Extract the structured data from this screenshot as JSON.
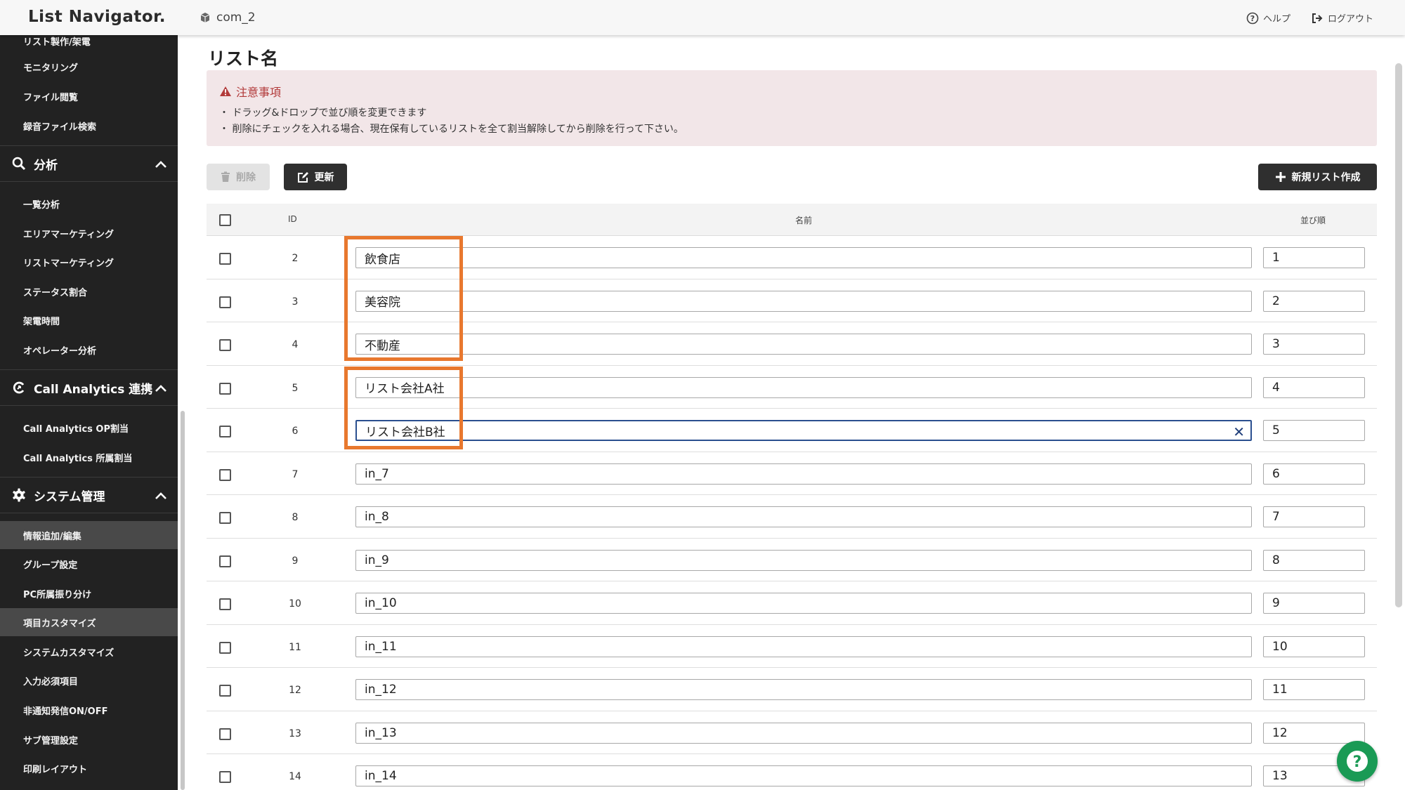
{
  "header": {
    "logo": "List Navigator.",
    "company": "com_2",
    "help": "ヘルプ",
    "logout": "ログアウト"
  },
  "sidebar": {
    "group1": [
      "リスト製作/架電",
      "モニタリング",
      "ファイル閲覧",
      "録音ファイル検索"
    ],
    "analysis": {
      "title": "分析",
      "items": [
        "一覧分析",
        "エリアマーケティング",
        "リストマーケティング",
        "ステータス割合",
        "架電時間",
        "オペレーター分析"
      ]
    },
    "call_analytics": {
      "title": "Call Analytics 連携",
      "items": [
        "Call Analytics OP割当",
        "Call Analytics 所属割当"
      ]
    },
    "system": {
      "title": "システム管理",
      "items": [
        "情報追加/編集",
        "グループ設定",
        "PC所属振り分け",
        "項目カスタマイズ",
        "システムカスタマイズ",
        "入力必須項目",
        "非通知発信ON/OFF",
        "サブ管理設定",
        "印刷レイアウト"
      ]
    }
  },
  "main": {
    "title": "リスト名",
    "notice": {
      "title": "注意事項",
      "lines": [
        "・ ドラッグ&ドロップで並び順を変更できます",
        "・ 削除にチェックを入れる場合、現在保有しているリストを全て割当解除してから削除を行って下さい。"
      ]
    },
    "buttons": {
      "delete": "削除",
      "update": "更新",
      "new_list": "新規リスト作成"
    },
    "table": {
      "headers": {
        "id": "ID",
        "name": "名前",
        "order": "並び順"
      },
      "rows": [
        {
          "id": "2",
          "name": "飲食店",
          "order": "1"
        },
        {
          "id": "3",
          "name": "美容院",
          "order": "2"
        },
        {
          "id": "4",
          "name": "不動産",
          "order": "3"
        },
        {
          "id": "5",
          "name": "リスト会社A社",
          "order": "4"
        },
        {
          "id": "6",
          "name": "リスト会社B社",
          "order": "5"
        },
        {
          "id": "7",
          "name": "in_7",
          "order": "6"
        },
        {
          "id": "8",
          "name": "in_8",
          "order": "7"
        },
        {
          "id": "9",
          "name": "in_9",
          "order": "8"
        },
        {
          "id": "10",
          "name": "in_10",
          "order": "9"
        },
        {
          "id": "11",
          "name": "in_11",
          "order": "10"
        },
        {
          "id": "12",
          "name": "in_12",
          "order": "11"
        },
        {
          "id": "13",
          "name": "in_13",
          "order": "12"
        },
        {
          "id": "14",
          "name": "in_14",
          "order": "13"
        }
      ]
    }
  },
  "colors": {
    "sidebar_bg": "#222222",
    "highlight": "#e8782e",
    "notice_bg": "#f2e6e8",
    "warning_red": "#b23a3a",
    "focus_blue": "#2a4f8f",
    "help_fab": "#1a9a55"
  },
  "icons": {
    "company": "cube-icon",
    "help": "question-circle-icon",
    "logout": "sign-out-icon",
    "analysis": "search-icon",
    "call_analytics": "call-analytics-icon",
    "system": "gear-icon",
    "warning": "warning-triangle-icon",
    "delete": "trash-icon",
    "update": "edit-icon",
    "new_list": "plus-icon",
    "clear": "close-icon",
    "fab": "help-fab-icon"
  }
}
